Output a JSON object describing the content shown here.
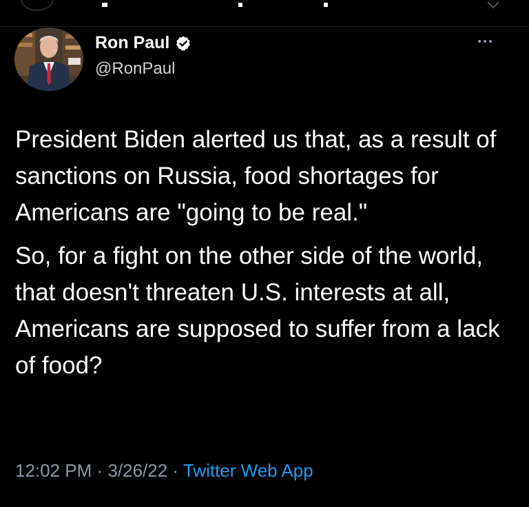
{
  "tweet": {
    "author": {
      "display_name": "Ron Paul",
      "handle": "@RonPaul",
      "verified": true,
      "avatar": "profile-photo"
    },
    "paragraphs": [
      "President Biden alerted us that, as a result of sanctions on Russia, food shortages for Americans are \"going to be real.\"",
      "So, for a fight on the other side of the world, that doesn't threaten U.S. interests at all, Americans are supposed to suffer from a lack of food?"
    ],
    "time": "12:02 PM",
    "date": "3/26/22",
    "separator": "·",
    "source": "Twitter Web App"
  },
  "colors": {
    "background": "#000000",
    "text": "#ffffff",
    "secondary": "#8b98a5",
    "link": "#1d9bf0",
    "verified_badge": "#ffffff"
  },
  "icons": {
    "verified": "verified-badge-icon",
    "more": "more-options-icon",
    "back": "back-arrow-icon"
  }
}
